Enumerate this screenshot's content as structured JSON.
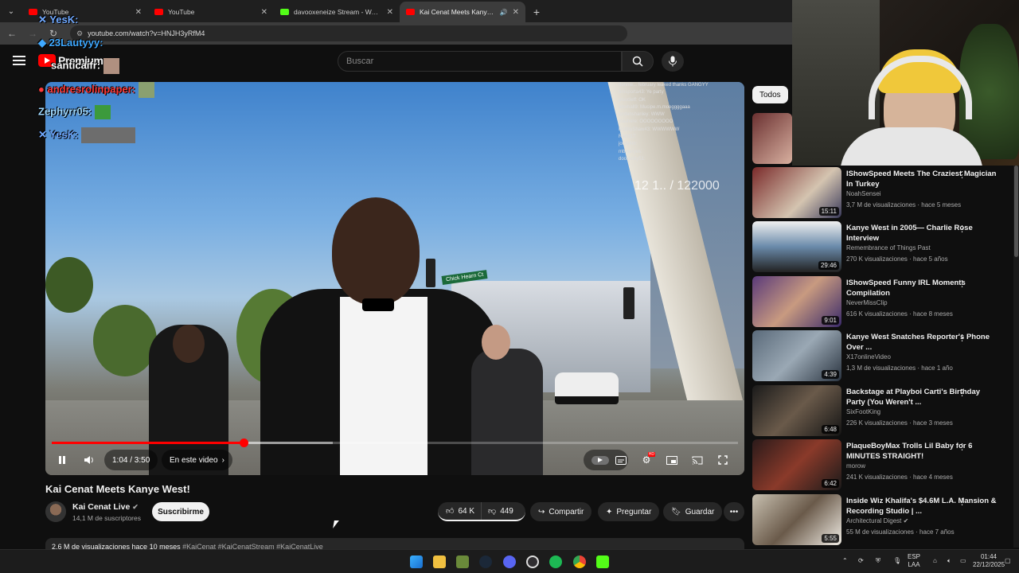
{
  "browser": {
    "tabs": [
      {
        "title": "YouTube",
        "favicon": "youtube-icon",
        "active": false
      },
      {
        "title": "YouTube",
        "favicon": "youtube-icon",
        "active": false
      },
      {
        "title": "davooxeneize Stream - Watch L",
        "favicon": "kick-icon",
        "active": false
      },
      {
        "title": "Kai Cenat Meets Kanye We",
        "favicon": "youtube-icon",
        "active": true
      }
    ],
    "url": "youtube.com/watch?v=HNJH3yRfM4"
  },
  "youtube": {
    "logo_text": "Premium",
    "search_placeholder": "Buscar"
  },
  "video": {
    "title": "Kai Cenat Meets Kanye West!",
    "time": "1:04 / 3:50",
    "chapter": "En este video",
    "progress_fraction": 0.28,
    "buffered_fraction": 0.41,
    "counter_overlay": "12 1.. / 122000",
    "street_sign": "Chick Hearn Ct",
    "stream_chat": [
      "donnie... february leaked thanks GANGYY",
      "bmsporta43: Ye party",
      "pluvcleff: OK",
      "alexhall9: Mucipe.m.moeggggaaa",
      "jordanshanley: WWW",
      "jnashere: OOOOOOOOO",
      "RobbyShaw43: WWWWWW",
      "Ramt17:",
      "jorde4m:",
      "mbmeryes:",
      "dooklebly51:"
    ]
  },
  "channel": {
    "name": "Kai Cenat Live",
    "subscribers": "14,1 M de suscriptores",
    "subscribe_label": "Suscribirme"
  },
  "actions": {
    "likes": "64 K",
    "dislikes": "449",
    "share": "Compartir",
    "ask": "Preguntar",
    "save": "Guardar"
  },
  "description": {
    "stats": "2,6 M de visualizaciones  hace 10 meses",
    "tags": "#KaiCenat #KaiCenatStream #KaiCenatLive"
  },
  "sidebar": {
    "chip": "Todos",
    "items": [
      {
        "title": "IShowSpeed Meets The Craziest Magician In Turkey",
        "channel": "NoahSensei",
        "meta": "3,7 M de visualizaciones · hace 5 meses",
        "duration": "15:11"
      },
      {
        "title": "Kanye West in 2005— Charlie Rose Interview",
        "channel": "Remembrance of Things Past",
        "meta": "270 K visualizaciones · hace 5 años",
        "duration": "29:46"
      },
      {
        "title": "IShowSpeed Funny IRL Moments Compilation",
        "channel": "NeverMissClip",
        "meta": "616 K visualizaciones · hace 8 meses",
        "duration": "9:01"
      },
      {
        "title": "Kanye West Snatches Reporter's Phone Over ...",
        "channel": "X17onlineVideo",
        "meta": "1,3 M de visualizaciones · hace 1 año",
        "duration": "4:39"
      },
      {
        "title": "Backstage at Playboi Carti's Birthday Party (You Weren't ...",
        "channel": "SixFootKing",
        "meta": "226 K visualizaciones · hace 3 meses",
        "duration": "6:48"
      },
      {
        "title": "PlaqueBoyMax Trolls Lil Baby for 6 MINUTES STRAIGHT!",
        "channel": "morow",
        "meta": "241 K visualizaciones · hace 4 meses",
        "duration": "6:42"
      },
      {
        "title": "Inside Wiz Khalifa's $4.6M L.A. Mansion & Recording Studio | ...",
        "channel": "Architectural Digest",
        "meta": "55 M de visualizaciones · hace 7 años",
        "duration": "5:55"
      }
    ]
  },
  "overlay_chat": [
    {
      "user": "YesK:",
      "color": "#6fa8ff"
    },
    {
      "user": "23Lautyyy:",
      "color": "#3fa9ff"
    },
    {
      "user": "santicaifr:",
      "color": "#ffffff"
    },
    {
      "user": "andresrolinpaper:",
      "color": "#ff3b3b"
    },
    {
      "user": "Zephyrr05:",
      "color": "#9fd9ff"
    },
    {
      "user": "YesK:",
      "color": "#6fa8ff"
    }
  ],
  "taskbar": {
    "language": "ESP",
    "layout": "LAA",
    "time": "01:44",
    "date": "22/12/2025"
  }
}
